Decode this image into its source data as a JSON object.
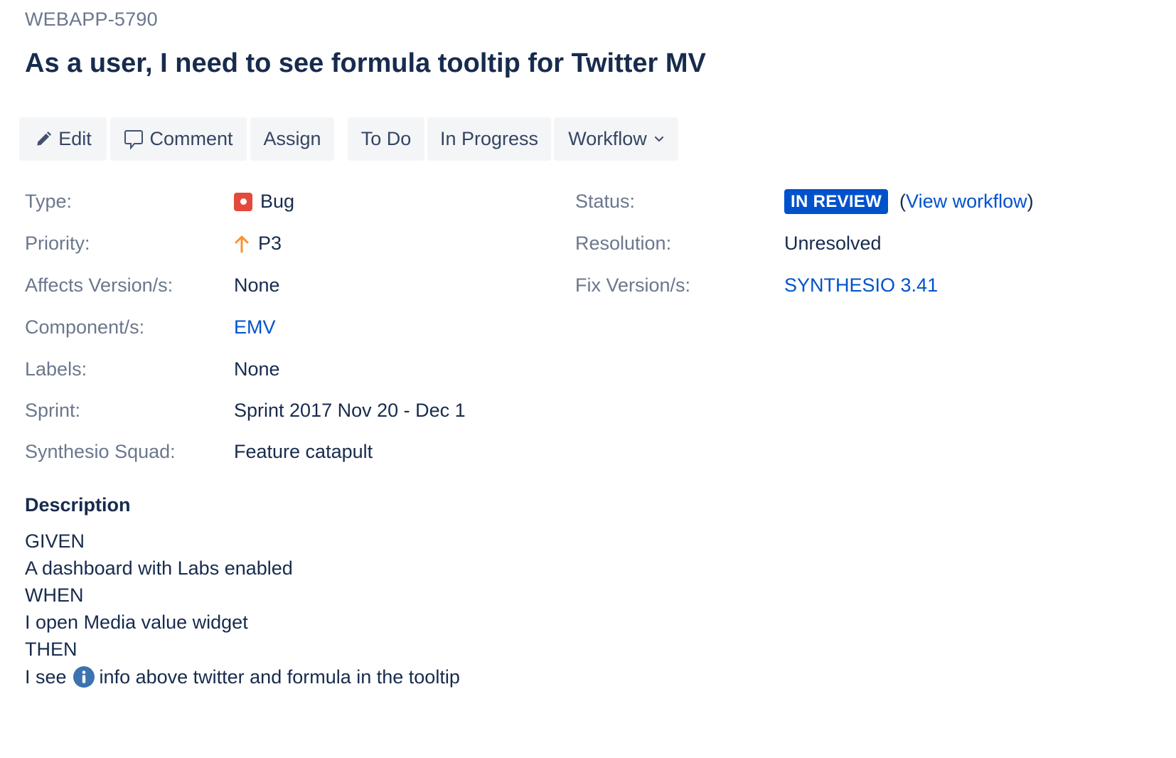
{
  "issue": {
    "key": "WEBAPP-5790",
    "title": "As a user, I need to see formula tooltip for Twitter MV"
  },
  "toolbar": {
    "edit_label": "Edit",
    "comment_label": "Comment",
    "assign_label": "Assign",
    "todo_label": "To Do",
    "in_progress_label": "In Progress",
    "workflow_label": "Workflow"
  },
  "details": {
    "type": {
      "label": "Type:",
      "value": "Bug",
      "icon": "bug-icon",
      "icon_color": "#e5493a"
    },
    "priority": {
      "label": "Priority:",
      "value": "P3",
      "icon": "arrow-up-icon",
      "icon_color": "#f79232"
    },
    "affects_versions": {
      "label": "Affects Version/s:",
      "value": "None"
    },
    "components": {
      "label": "Component/s:",
      "value": "EMV"
    },
    "labels": {
      "label": "Labels:",
      "value": "None"
    },
    "sprint": {
      "label": "Sprint:",
      "value": "Sprint 2017 Nov 20 - Dec 1"
    },
    "squad": {
      "label": "Synthesio Squad:",
      "value": "Feature catapult"
    },
    "status": {
      "label": "Status:",
      "value": "IN REVIEW",
      "color": "#0052cc",
      "link_open": "(",
      "link_text": "View workflow",
      "link_close": ")"
    },
    "resolution": {
      "label": "Resolution:",
      "value": "Unresolved"
    },
    "fix_versions": {
      "label": "Fix Version/s:",
      "value": "SYNTHESIO 3.41"
    }
  },
  "description": {
    "heading": "Description",
    "lines": [
      "GIVEN",
      "A dashboard with Labs enabled",
      "WHEN",
      "I open Media value widget",
      "THEN"
    ],
    "last_line_before": "I see",
    "last_line_after": "info above twitter and formula in the tooltip"
  },
  "colors": {
    "link": "#0052cc",
    "label": "#6b778c",
    "text": "#172b4d",
    "button_bg": "#f4f5f7"
  }
}
